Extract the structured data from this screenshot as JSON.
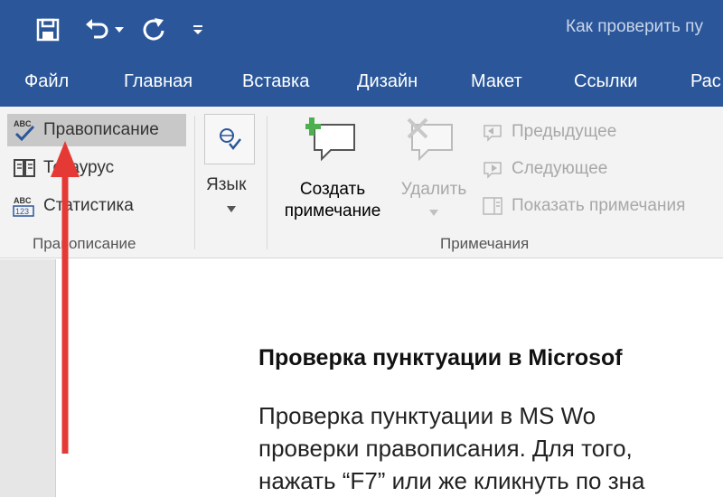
{
  "titlebar": {
    "document_title": "Как проверить пу"
  },
  "tabs": [
    "Файл",
    "Главная",
    "Вставка",
    "Дизайн",
    "Макет",
    "Ссылки",
    "Рас"
  ],
  "ribbon": {
    "proofing": {
      "spelling": "Правописание",
      "thesaurus": "Тезаурус",
      "statistics": "Статистика",
      "group_label": "Правописание",
      "icon_abc": "ABC",
      "icon_123": "123"
    },
    "language": {
      "label": "Язык"
    },
    "comments": {
      "new_comment_line1": "Создать",
      "new_comment_line2": "примечание",
      "delete": "Удалить",
      "previous": "Предыдущее",
      "next": "Следующее",
      "show_comments": "Показать примечания",
      "group_label": "Примечания"
    }
  },
  "document": {
    "heading": "Проверка пунктуации в Microsof",
    "lines": [
      "Проверка   пунктуации   в   MS   Wo",
      "проверки правописания. Для того,",
      "нажать “F7” или же кликнуть по зна"
    ]
  },
  "colors": {
    "titlebar": "#2b579a",
    "ribbon": "#f3f3f3",
    "arrow": "#e53935"
  }
}
